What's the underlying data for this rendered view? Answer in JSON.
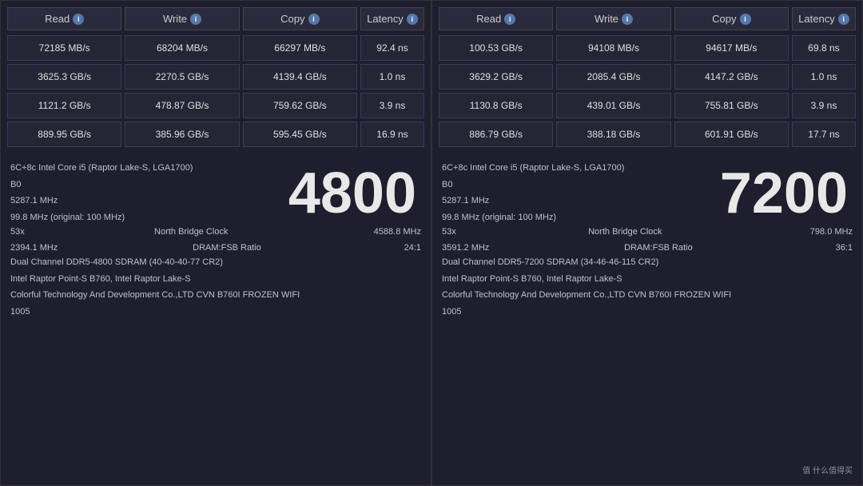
{
  "left": {
    "header": {
      "read": "Read",
      "write": "Write",
      "copy": "Copy",
      "latency": "Latency"
    },
    "rows": [
      {
        "read": "72185 MB/s",
        "write": "68204 MB/s",
        "copy": "66297 MB/s",
        "latency": "92.4 ns"
      },
      {
        "read": "3625.3 GB/s",
        "write": "2270.5 GB/s",
        "copy": "4139.4 GB/s",
        "latency": "1.0 ns"
      },
      {
        "read": "1121.2 GB/s",
        "write": "478.87 GB/s",
        "copy": "759.62 GB/s",
        "latency": "3.9 ns"
      },
      {
        "read": "889.95 GB/s",
        "write": "385.96 GB/s",
        "copy": "595.45 GB/s",
        "latency": "16.9 ns"
      }
    ],
    "info": {
      "cpu": "6C+8c Intel Core i5  (Raptor Lake-S, LGA1700)",
      "stepping": "B0",
      "freq": "5287.1 MHz",
      "fsb": "99.8 MHz  (original: 100 MHz)",
      "multiplier": "53x",
      "north_bridge_label": "North Bridge Clock",
      "north_bridge_value": "4588.8 MHz",
      "dram_freq": "2394.1 MHz",
      "dram_fsb_label": "DRAM:FSB Ratio",
      "dram_fsb_value": "24:1",
      "dram_type": "Dual Channel DDR5-4800 SDRAM  (40-40-40-77 CR2)",
      "chipset": "Intel Raptor Point-S B760, Intel Raptor Lake-S",
      "board": "Colorful Technology And Development Co.,LTD CVN B760I FROZEN WIFI",
      "bios": "1005",
      "big_number": "4800"
    }
  },
  "right": {
    "header": {
      "read": "Read",
      "write": "Write",
      "copy": "Copy",
      "latency": "Latency"
    },
    "rows": [
      {
        "read": "100.53 GB/s",
        "write": "94108 MB/s",
        "copy": "94617 MB/s",
        "latency": "69.8 ns"
      },
      {
        "read": "3629.2 GB/s",
        "write": "2085.4 GB/s",
        "copy": "4147.2 GB/s",
        "latency": "1.0 ns"
      },
      {
        "read": "1130.8 GB/s",
        "write": "439.01 GB/s",
        "copy": "755.81 GB/s",
        "latency": "3.9 ns"
      },
      {
        "read": "886.79 GB/s",
        "write": "388.18 GB/s",
        "copy": "601.91 GB/s",
        "latency": "17.7 ns"
      }
    ],
    "info": {
      "cpu": "6C+8c Intel Core i5  (Raptor Lake-S, LGA1700)",
      "stepping": "B0",
      "freq": "5287.1 MHz",
      "fsb": "99.8 MHz  (original: 100 MHz)",
      "multiplier": "53x",
      "north_bridge_label": "North Bridge Clock",
      "north_bridge_value": "798.0 MHz",
      "dram_freq": "3591.2 MHz",
      "dram_fsb_label": "DRAM:FSB Ratio",
      "dram_fsb_value": "36:1",
      "dram_type": "Dual Channel DDR5-7200 SDRAM  (34-46-46-115 CR2)",
      "chipset": "Intel Raptor Point-S B760, Intel Raptor Lake-S",
      "board": "Colorful Technology And Development Co.,LTD CVN B760I FROZEN WIFI",
      "bios": "1005",
      "big_number": "7200"
    }
  },
  "watermark": "值 什么值得买"
}
